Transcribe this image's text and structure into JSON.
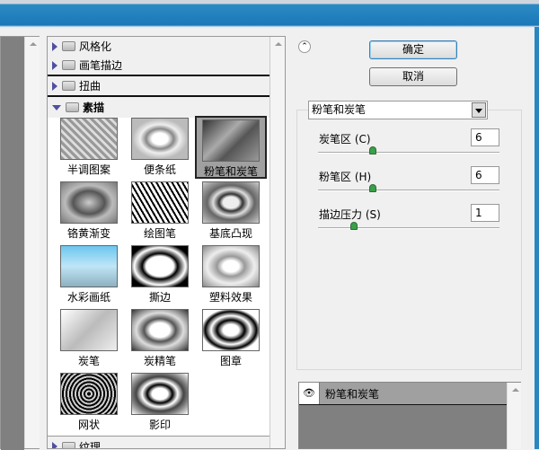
{
  "categories": {
    "stylize": "风格化",
    "brush": "画笔描边",
    "distort": "扭曲",
    "sketch": "素描",
    "texture": "纹理"
  },
  "filters": [
    {
      "label": "半调图案",
      "bg": "repeating-linear-gradient(45deg,#999 0 3px,#ddd 3px 6px)"
    },
    {
      "label": "便条纸",
      "bg": "radial-gradient(ellipse at 50% 50%,#fff 20%,#888 35%,#eee 50%,#bbb 70%)"
    },
    {
      "label": "粉笔和炭笔",
      "bg": "linear-gradient(135deg,#333,#aaa 40%,#555 60%,#999)"
    },
    {
      "label": "铬黄渐变",
      "bg": "radial-gradient(ellipse,#ccc,#555 40%,#bbb 60%,#777)"
    },
    {
      "label": "绘图笔",
      "bg": "repeating-linear-gradient(60deg,#000 0 2px,#fff 2px 5px)"
    },
    {
      "label": "基底凸现",
      "bg": "radial-gradient(ellipse,#eee 20%,#333 30%,#ddd 45%,#666 60%,#ccc)"
    },
    {
      "label": "水彩画纸",
      "bg": "linear-gradient(#6cc6f0,#bfe6f6 50%,#8db0c0)"
    },
    {
      "label": "撕边",
      "bg": "radial-gradient(ellipse,#fff 35%,#000 45%,#fff 65%,#000 80%)"
    },
    {
      "label": "塑料效果",
      "bg": "radial-gradient(ellipse,#fff 20%,#999 35%,#eee 60%,#888)"
    },
    {
      "label": "炭笔",
      "bg": "linear-gradient(135deg,#fff,#bbb 50%,#eee)"
    },
    {
      "label": "炭精笔",
      "bg": "radial-gradient(ellipse,#fff 25%,#555 40%,#ddd 60%,#333)"
    },
    {
      "label": "图章",
      "bg": "radial-gradient(ellipse,#fff 20%,#000 35%,#fff 50%,#000 65%,#fff 75%)"
    },
    {
      "label": "网状",
      "bg": "repeating-radial-gradient(circle,#000 0 2px,#ccc 2px 4px)"
    },
    {
      "label": "影印",
      "bg": "radial-gradient(ellipse,#fff 20%,#000 32%,#fff 45%,#444 60%,#fff)"
    }
  ],
  "buttons": {
    "ok": "确定",
    "cancel": "取消"
  },
  "filter_select": "粉笔和炭笔",
  "params": [
    {
      "label": "炭笔区 (C)",
      "value": "6",
      "fraction": 0.3
    },
    {
      "label": "粉笔区 (H)",
      "value": "6",
      "fraction": 0.3
    },
    {
      "label": "描边压力 (S)",
      "value": "1",
      "fraction": 0.2
    }
  ],
  "layer": {
    "name": "粉笔和炭笔",
    "eye": "👁"
  }
}
